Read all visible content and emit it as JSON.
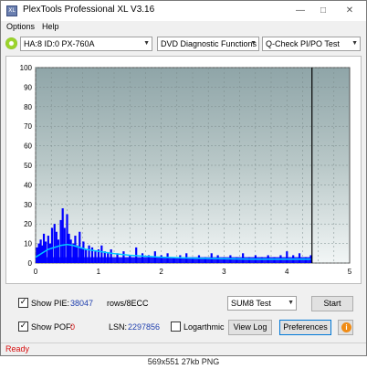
{
  "window": {
    "title": "PlexTools Professional XL V3.16",
    "app_icon_text": "XL"
  },
  "menu": {
    "options": "Options",
    "help": "Help"
  },
  "toolbar": {
    "drive": "HA:8 ID:0  PX-760A",
    "function": "DVD Diagnostic Functions",
    "test": "Q-Check PI/PO Test"
  },
  "chart_data": {
    "type": "bar",
    "x_ticks": [
      "0",
      "1",
      "2",
      "3",
      "4",
      "5"
    ],
    "y_ticks": [
      "0",
      "10",
      "20",
      "30",
      "40",
      "50",
      "60",
      "70",
      "80",
      "90",
      "100"
    ],
    "xlim": [
      0,
      5
    ],
    "ylim": [
      0,
      100
    ],
    "end_marker_x": 4.4,
    "grid": true,
    "background": "#b9c8c8",
    "series": [
      {
        "color": "#0000ff",
        "x": [
          0.02,
          0.05,
          0.08,
          0.1,
          0.13,
          0.16,
          0.2,
          0.23,
          0.26,
          0.3,
          0.33,
          0.36,
          0.4,
          0.43,
          0.46,
          0.5,
          0.53,
          0.56,
          0.6,
          0.63,
          0.66,
          0.7,
          0.73,
          0.76,
          0.8,
          0.85,
          0.9,
          0.95,
          1.0,
          1.05,
          1.1,
          1.15,
          1.2,
          1.3,
          1.4,
          1.5,
          1.6,
          1.7,
          1.8,
          1.9,
          2.0,
          2.1,
          2.2,
          2.3,
          2.4,
          2.5,
          2.6,
          2.7,
          2.8,
          2.9,
          3.0,
          3.1,
          3.2,
          3.3,
          3.4,
          3.5,
          3.6,
          3.7,
          3.8,
          3.9,
          4.0,
          4.1,
          4.2,
          4.3,
          4.38
        ],
        "values": [
          8,
          10,
          12,
          9,
          15,
          11,
          14,
          10,
          18,
          20,
          16,
          12,
          22,
          28,
          18,
          25,
          15,
          12,
          10,
          14,
          9,
          16,
          8,
          11,
          7,
          9,
          8,
          6,
          7,
          9,
          6,
          5,
          7,
          5,
          6,
          4,
          8,
          5,
          4,
          6,
          4,
          5,
          3,
          4,
          5,
          3,
          4,
          3,
          5,
          4,
          3,
          4,
          3,
          5,
          3,
          4,
          3,
          4,
          3,
          4,
          6,
          4,
          5,
          3,
          4
        ]
      },
      {
        "color": "#00c8ff",
        "x": [
          0.0,
          0.1,
          0.2,
          0.3,
          0.4,
          0.5,
          0.6,
          0.7,
          0.8,
          1.0,
          1.2,
          1.5,
          2.0,
          2.5,
          3.0,
          3.5,
          4.0,
          4.38
        ],
        "values": [
          3,
          5,
          7,
          8,
          9,
          9.5,
          9,
          8,
          7,
          6,
          5,
          4,
          3,
          2.5,
          2.2,
          2,
          2,
          2
        ]
      }
    ]
  },
  "controls": {
    "show_pie_label": "Show PIE:",
    "pie_value": "38047",
    "pie_unit": "rows/8ECC",
    "show_pof_label": "Show POF:",
    "pof_value": "0",
    "lsn_label": "LSN:",
    "lsn_value": "2297856",
    "logarithmic_label": "Logarthmic",
    "test_mode": "SUM8 Test",
    "start_label": "Start",
    "view_log_label": "View Log",
    "preferences_label": "Preferences",
    "info_icon": "info-icon"
  },
  "status": {
    "text": "Ready"
  },
  "caption": "569x551 27kb PNG"
}
